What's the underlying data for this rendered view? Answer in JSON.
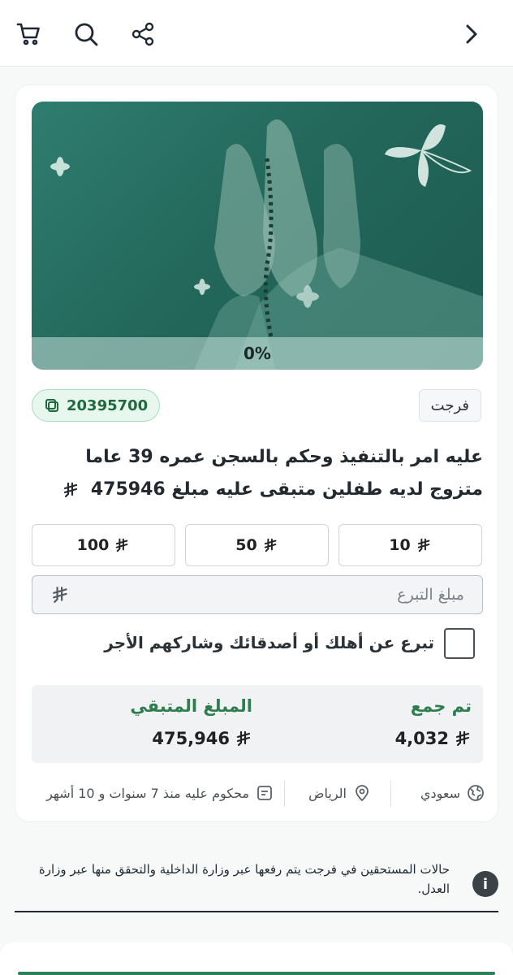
{
  "header": {
    "icons": [
      "cart-icon",
      "search-icon",
      "share-icon",
      "chevron-right-icon"
    ]
  },
  "hero": {
    "progress_label": "0%",
    "progress_fraction": 0,
    "image": "hands-raised-in-prayer-holding-prayer-beads"
  },
  "case": {
    "category_tag": "فرجت",
    "case_id": "20395700",
    "description": "عليه امر بالتنفيذ وحكم بالسجن عمره 39 عاما متزوج لديه طفلين متبقى عليه مبلغ 475946"
  },
  "amount_options": [
    {
      "label": "10"
    },
    {
      "label": "50"
    },
    {
      "label": "100"
    }
  ],
  "donation_input": {
    "placeholder": "مبلغ التبرع",
    "value": ""
  },
  "share_option": {
    "label": "تبرع عن أهلك أو أصدقائك وشاركهم الأجر",
    "checked": false
  },
  "stats": {
    "collected_label": "تم جمع",
    "collected_value": "4,032",
    "remaining_label": "المبلغ المتبقي",
    "remaining_value": "475,946"
  },
  "meta": {
    "nationality": "سعودي",
    "city": "الرياض",
    "sentence": "محكوم عليه منذ 7 سنوات و 10 أشهر"
  },
  "notice": {
    "text": "حالات المستحقين في فرجت يتم رفعها عبر وزارة الداخلية والتحقق منها عبر وزارة العدل."
  },
  "colors": {
    "brand_green": "#2e7d5b",
    "hero_teal": "#23685b",
    "badge_bg": "#e8f7ee"
  }
}
